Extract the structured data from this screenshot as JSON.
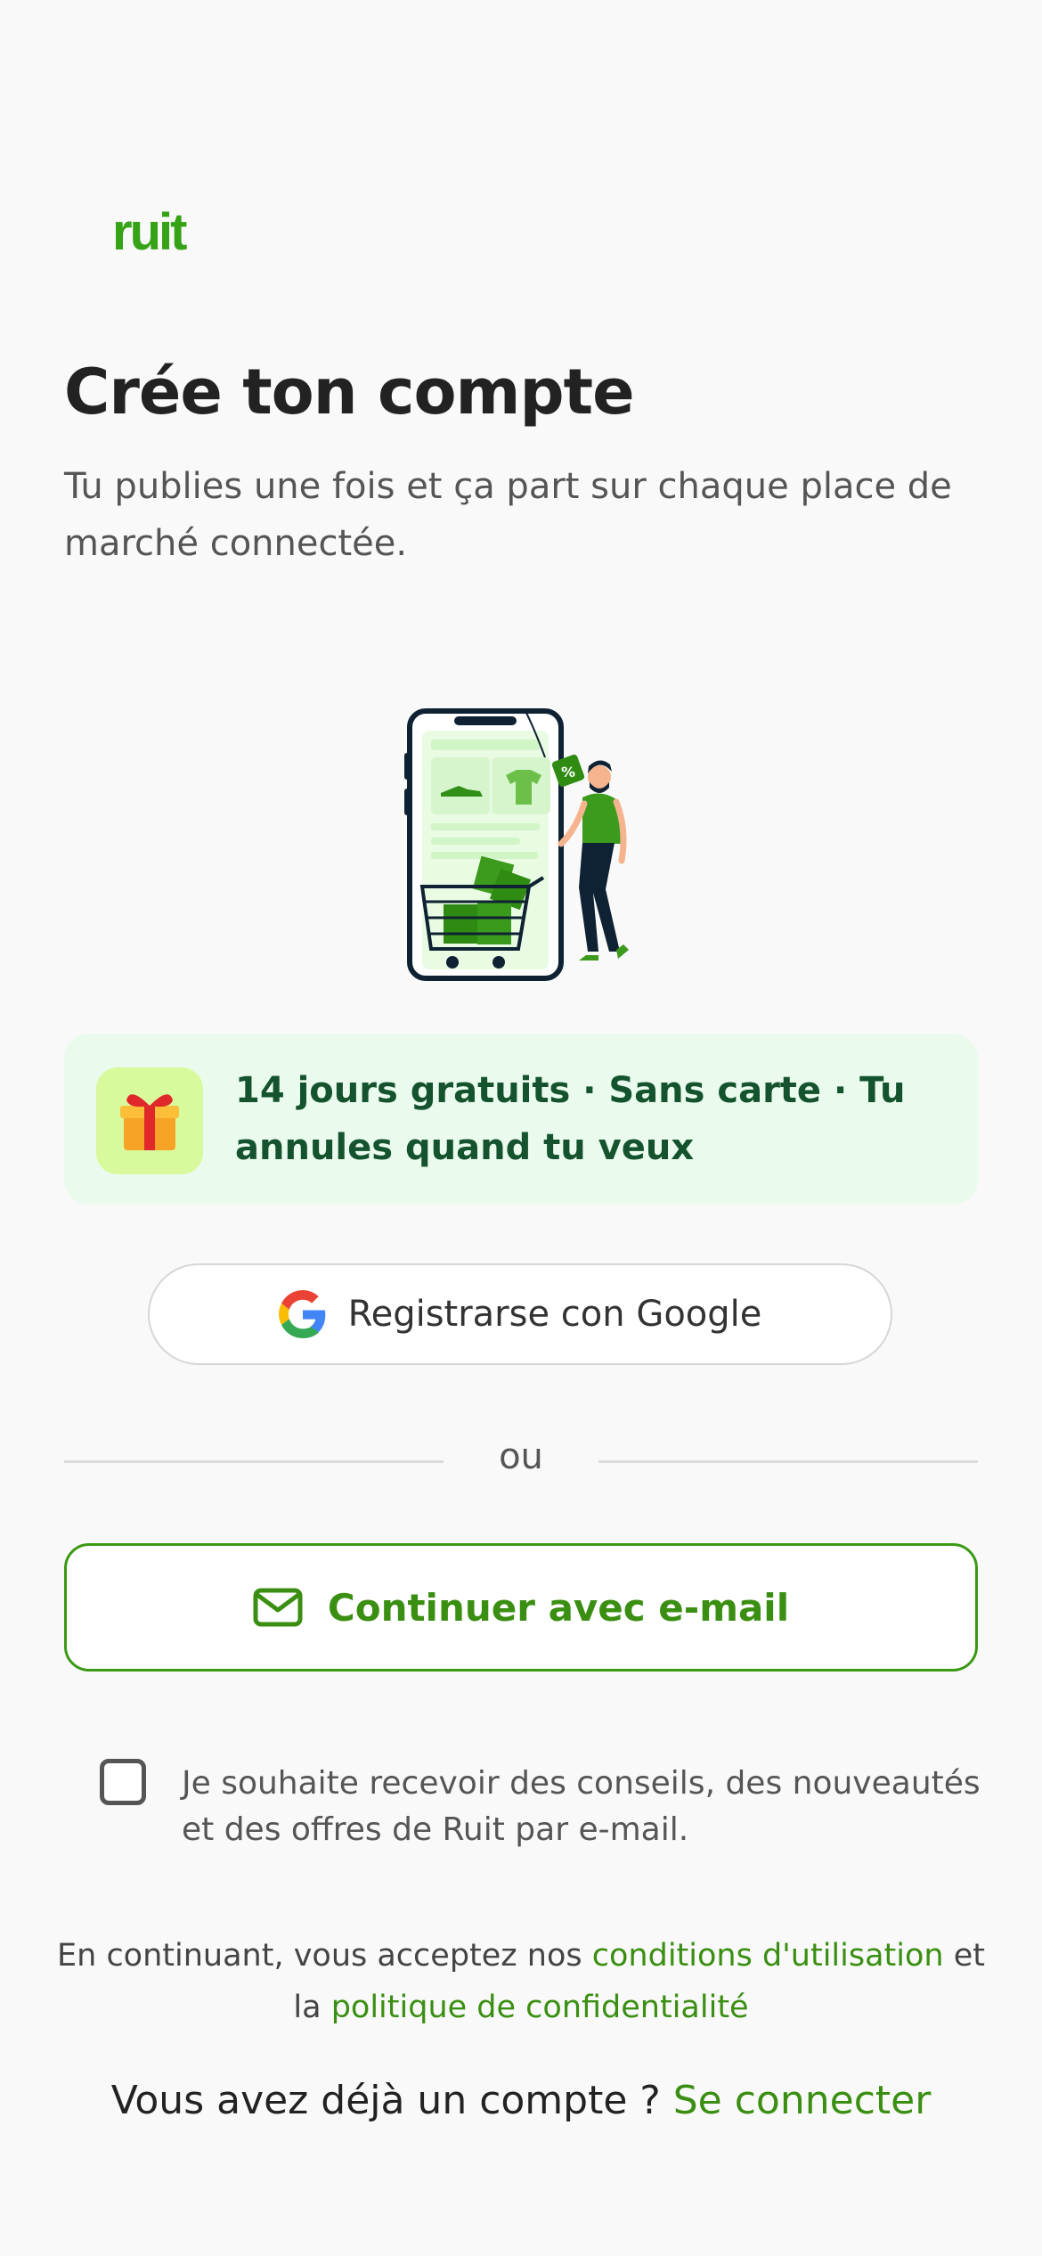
{
  "brand": {
    "logo_text": "ruit",
    "accent_color": "#35a315"
  },
  "header": {
    "title": "Crée ton compte",
    "subtitle": "Tu publies une fois et ça part sur chaque place de marché connectée."
  },
  "illustration": {
    "name": "shopping-phone-illustration",
    "tag_text": "%"
  },
  "promo": {
    "icon": "gift-icon",
    "text": "14 jours gratuits · Sans carte · Tu annules quand tu veux",
    "background": "#eafbee"
  },
  "google_button": {
    "icon": "google-icon",
    "label": "Registrarse con Google"
  },
  "divider": {
    "label": "ou"
  },
  "email_button": {
    "icon": "mail-icon",
    "label": "Continuer avec e-mail"
  },
  "newsletter": {
    "checked": false,
    "label": "Je souhaite recevoir des conseils, des nouveautés et des offres de Ruit par e-mail."
  },
  "terms": {
    "prefix": "En continuant, vous acceptez nos ",
    "terms_link": "conditions d'utilisation",
    "middle": " et la ",
    "privacy_link": "politique de confidentialité"
  },
  "login": {
    "prompt": "Vous avez déjà un compte ? ",
    "link": "Se connecter"
  }
}
